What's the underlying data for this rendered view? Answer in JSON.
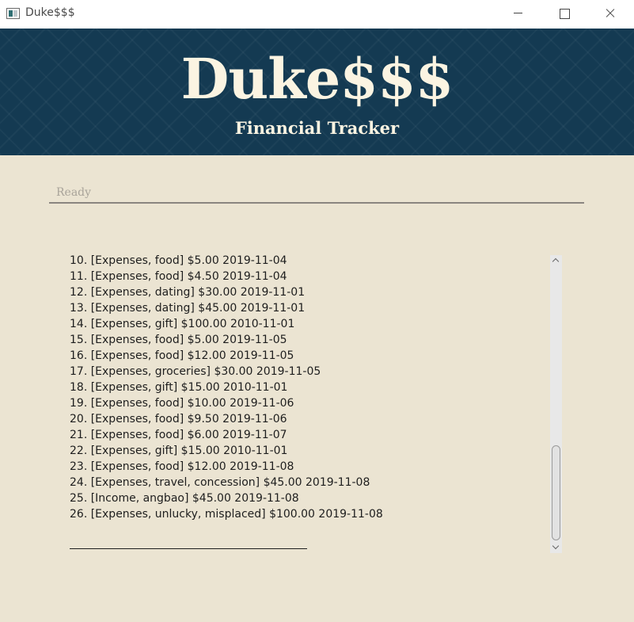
{
  "window": {
    "title": "Duke$$$"
  },
  "header": {
    "title": "Duke$$$",
    "subtitle": "Financial Tracker"
  },
  "command": {
    "value": "",
    "placeholder": "Ready"
  },
  "output": {
    "lines": [
      "10. [Expenses, food] $5.00 2019-11-04",
      "11. [Expenses, food] $4.50 2019-11-04",
      "12. [Expenses, dating] $30.00 2019-11-01",
      "13. [Expenses, dating] $45.00 2019-11-01",
      "14. [Expenses, gift] $100.00 2010-11-01",
      "15. [Expenses, food] $5.00 2019-11-05",
      "16. [Expenses, food] $12.00 2019-11-05",
      "17. [Expenses, groceries] $30.00 2019-11-05",
      "18. [Expenses, gift] $15.00 2010-11-01",
      "19. [Expenses, food] $10.00 2019-11-06",
      "20. [Expenses, food] $9.50 2019-11-06",
      "21. [Expenses, food] $6.00 2019-11-07",
      "22. [Expenses, gift] $15.00 2010-11-01",
      "23. [Expenses, food] $12.00 2019-11-08",
      "24. [Expenses, travel, concession] $45.00 2019-11-08",
      "25. [Income, angbao] $45.00 2019-11-08",
      "26. [Expenses, unlucky, misplaced] $100.00 2019-11-08"
    ]
  },
  "icons": {
    "app": "app-window-icon",
    "minimize": "minimize-icon",
    "maximize": "maximize-icon",
    "close": "close-icon",
    "scroll_up": "chevron-up-icon",
    "scroll_down": "chevron-down-icon"
  },
  "colors": {
    "banner": "#143a52",
    "background": "#ebe4d2",
    "title_text": "#fbf4e2"
  }
}
